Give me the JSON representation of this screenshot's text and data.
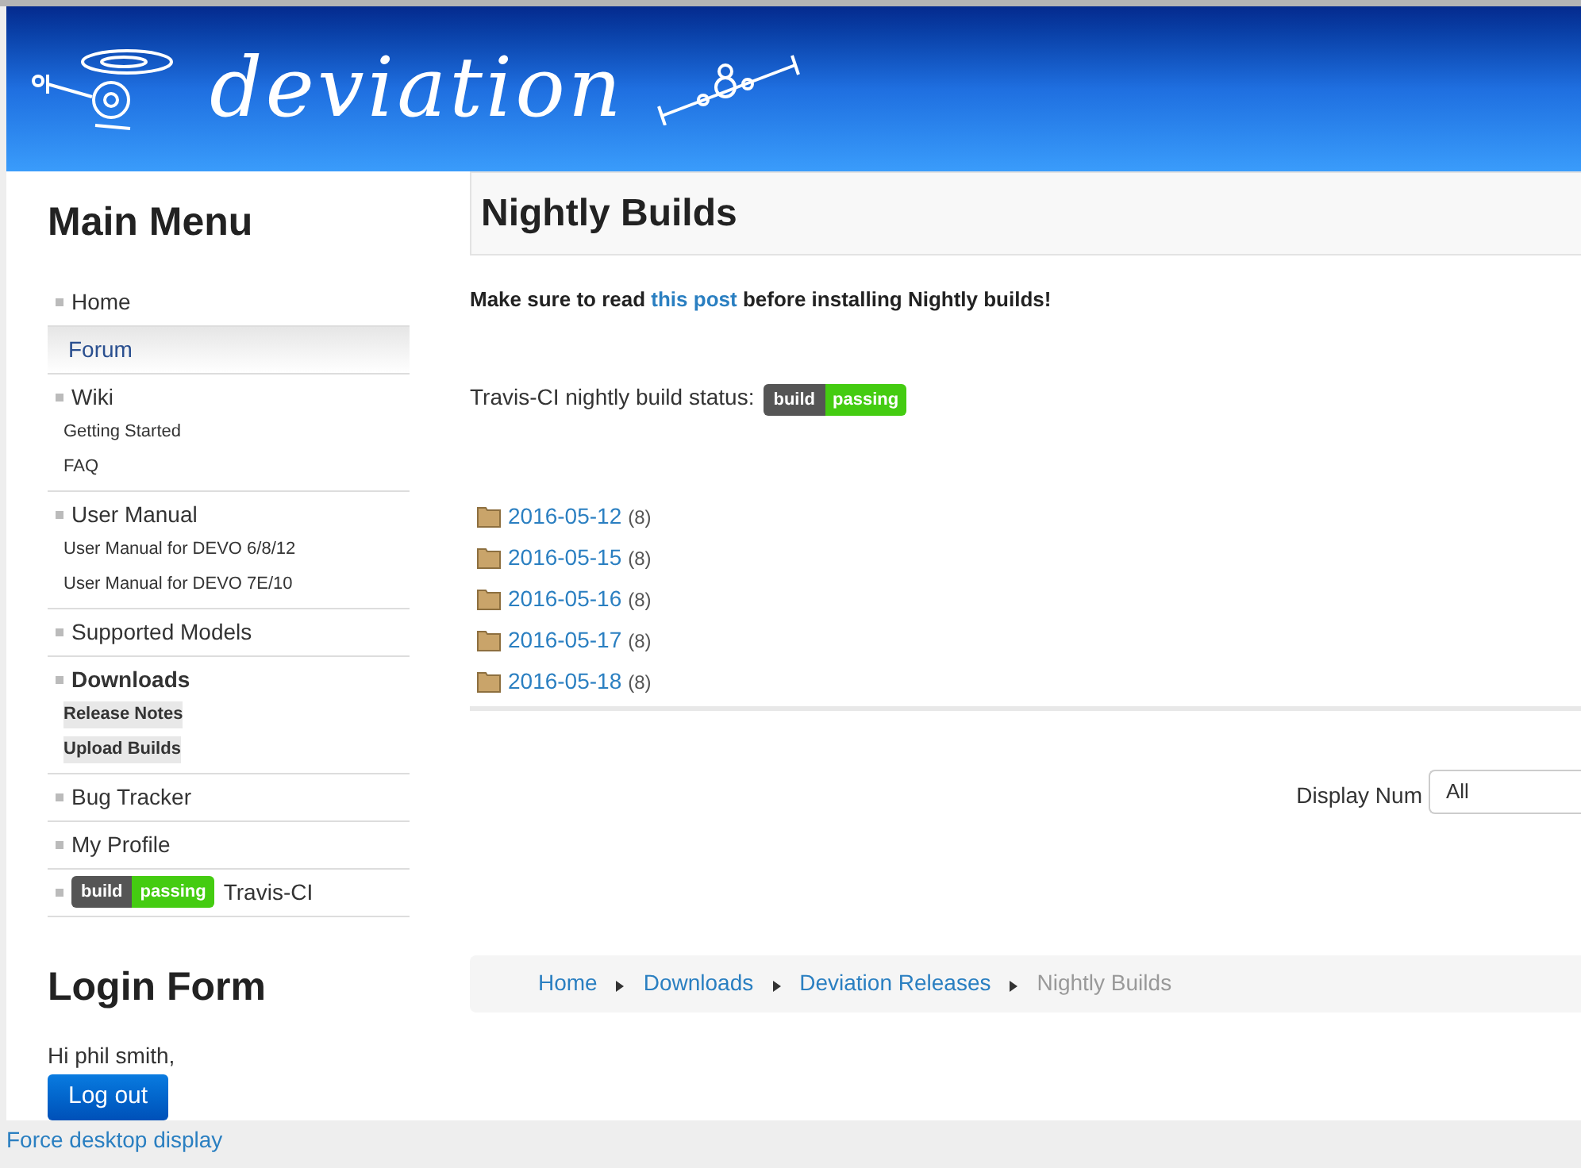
{
  "header": {
    "logo_text": "deviation"
  },
  "main_menu": {
    "title": "Main Menu",
    "items": [
      {
        "label": "Home",
        "kind": "link",
        "active": false,
        "highlighted": false
      },
      {
        "label": "Forum",
        "kind": "link",
        "active": false,
        "highlighted": true
      },
      {
        "label": "Wiki",
        "kind": "link",
        "active": false,
        "highlighted": false,
        "children": [
          {
            "label": "Getting Started",
            "highlighted": false
          },
          {
            "label": "FAQ",
            "highlighted": false
          }
        ]
      },
      {
        "label": "User Manual",
        "kind": "link",
        "active": false,
        "highlighted": false,
        "children": [
          {
            "label": "User Manual for DEVO 6/8/12",
            "highlighted": false
          },
          {
            "label": "User Manual for DEVO 7E/10",
            "highlighted": false
          }
        ]
      },
      {
        "label": "Supported Models",
        "kind": "link",
        "active": false,
        "highlighted": false
      },
      {
        "label": "Downloads",
        "kind": "link",
        "active": true,
        "highlighted": false,
        "children": [
          {
            "label": "Release Notes",
            "highlighted": true
          },
          {
            "label": "Upload Builds",
            "highlighted": true
          }
        ]
      },
      {
        "label": "Bug Tracker",
        "kind": "link",
        "active": false,
        "highlighted": false
      },
      {
        "label": "My Profile",
        "kind": "link",
        "active": false,
        "highlighted": false
      },
      {
        "label": "Travis-CI",
        "kind": "badge",
        "active": false,
        "highlighted": false,
        "badge": {
          "left": "build",
          "right": "passing"
        }
      }
    ]
  },
  "login_form": {
    "title": "Login Form",
    "greeting": "Hi phil smith,",
    "button": "Log out"
  },
  "page": {
    "title": "Nightly Builds",
    "notice_parts": [
      "Make sure to read ",
      "this post",
      " before installing Nightly builds!"
    ],
    "status_label": "Travis-CI nightly build status:",
    "status_badge": {
      "left": "build",
      "right": "passing"
    },
    "folders": [
      {
        "name": "2016-05-12",
        "count": "(8)"
      },
      {
        "name": "2016-05-15",
        "count": "(8)"
      },
      {
        "name": "2016-05-16",
        "count": "(8)"
      },
      {
        "name": "2016-05-17",
        "count": "(8)"
      },
      {
        "name": "2016-05-18",
        "count": "(8)"
      }
    ],
    "display_num": {
      "label": "Display Num",
      "value": "All"
    },
    "breadcrumb": [
      {
        "label": "Home",
        "current": false
      },
      {
        "label": "Downloads",
        "current": false
      },
      {
        "label": "Deviation Releases",
        "current": false
      },
      {
        "label": "Nightly Builds",
        "current": true
      }
    ]
  },
  "footer": {
    "link": "Force desktop display"
  }
}
